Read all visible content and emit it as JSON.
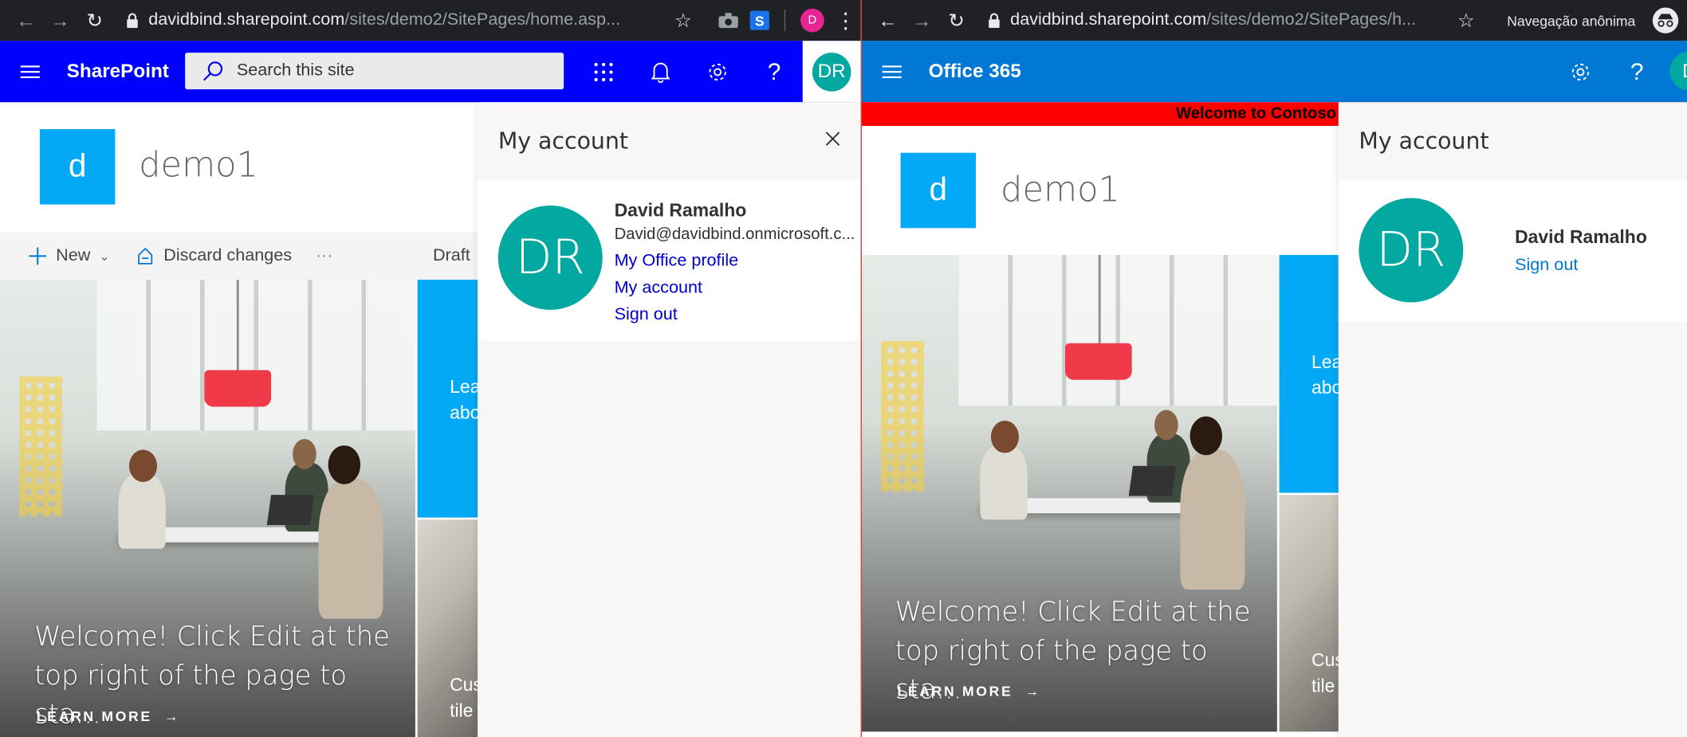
{
  "left": {
    "url_host": "davidbind.sharepoint.com",
    "url_path": "/sites/demo2/SitePages/home.asp...",
    "profile_chip": "D",
    "suite_brand": "SharePoint",
    "search_placeholder": "Search this site",
    "avatar_initials": "DR",
    "site_logo": "d",
    "site_title": "demo1",
    "cmd_new": "New",
    "cmd_discard": "Discard changes",
    "cmd_more": "···",
    "cmd_status": "Draft",
    "hero_text": "Welcome! Click Edit at the top right of the page to sta...",
    "learn_more": "LEARN MORE",
    "tile1_text": "Lea abo",
    "tile2_text": "Cus tile",
    "panel": {
      "title": "My account",
      "avatar": "DR",
      "name": "David Ramalho",
      "email": "David@davidbind.onmicrosoft.c...",
      "link_profile": "My Office profile",
      "link_account": "My account",
      "link_signout": "Sign out"
    }
  },
  "right": {
    "url_host": "davidbind.sharepoint.com",
    "url_path": "/sites/demo2/SitePages/h...",
    "incognito_label": "Navegação anônima",
    "suite_brand": "Office 365",
    "avatar_initials": "D",
    "welcome_banner": "Welcome to Contoso",
    "site_logo": "d",
    "site_title": "demo1",
    "hero_text": "Welcome! Click Edit at the top right of the page to sta...",
    "learn_more": "LEARN MORE",
    "tile1_text": "Lea abo",
    "tile2_text": "Cus tile",
    "panel": {
      "title": "My account",
      "avatar": "DR",
      "name": "David Ramalho",
      "link_signout": "Sign out"
    }
  },
  "colors": {
    "chrome": "#202124",
    "sp_suitebar_custom": "#0000ff",
    "o365_suitebar": "#0078d4",
    "site_logo_bg": "#03a9f4",
    "avatar_bg": "#03a9a1",
    "link_left": "#0000cc",
    "link_right": "#0078d4",
    "banner_red": "#ff0000"
  }
}
